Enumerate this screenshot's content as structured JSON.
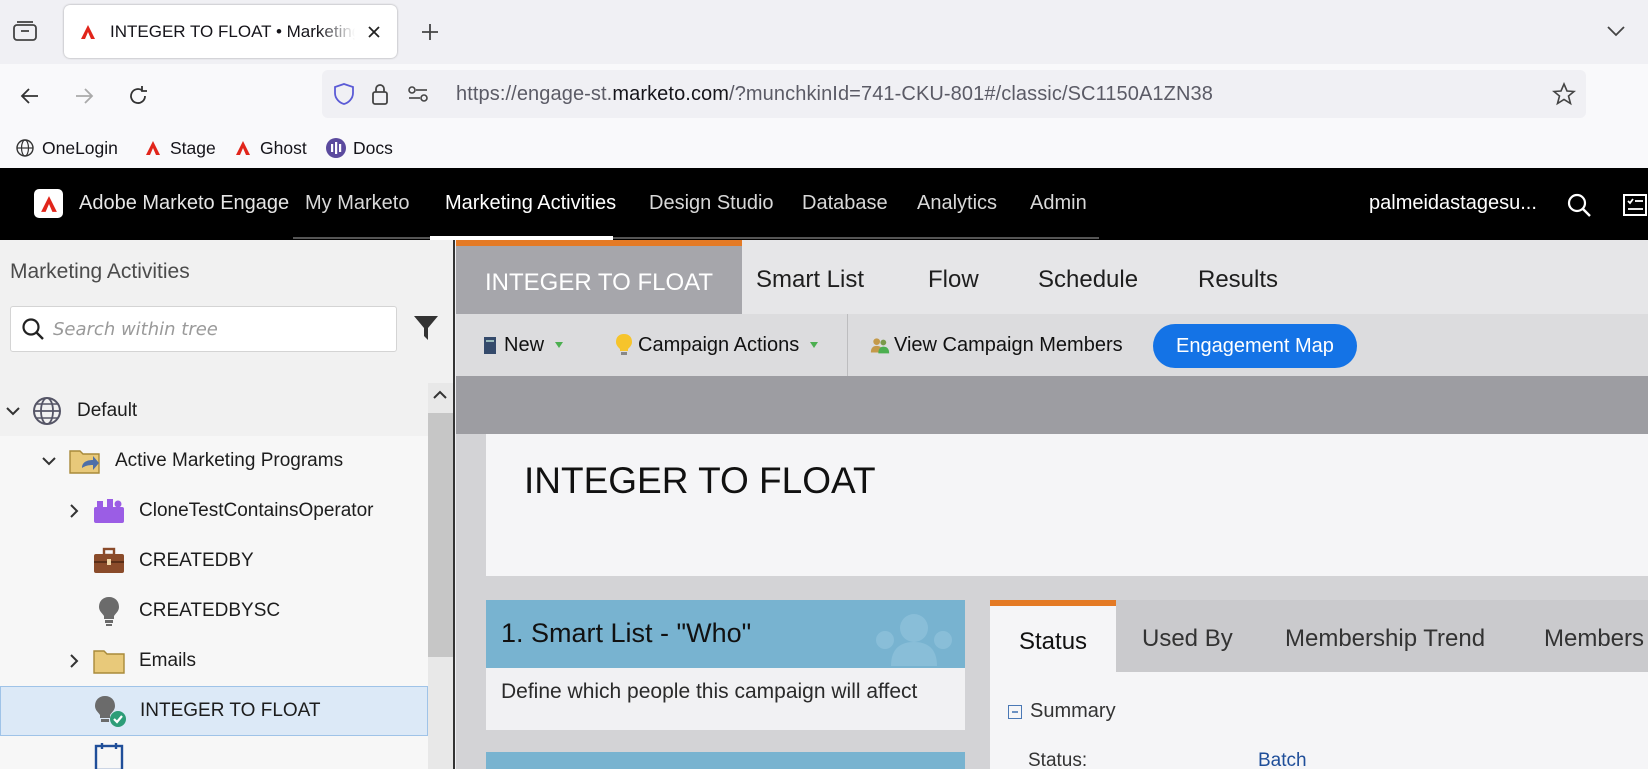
{
  "browser": {
    "tab_title": "INTEGER TO FLOAT • Marketing Activities",
    "url_prefix": "https://engage-st.",
    "url_domain": "marketo.com",
    "url_suffix": "/?munchkinId=741-CKU-801#/classic/SC1150A1ZN38",
    "bookmarks": [
      "OneLogin",
      "Stage",
      "Ghost",
      "Docs"
    ]
  },
  "header": {
    "brand": "Adobe Marketo Engage",
    "nav": [
      "My Marketo",
      "Marketing Activities",
      "Design Studio",
      "Database",
      "Analytics",
      "Admin"
    ],
    "active_nav": "Marketing Activities",
    "user": "palmeidastagesu..."
  },
  "tree": {
    "title": "Marketing Activities",
    "search_placeholder": "Search within tree",
    "items": [
      {
        "label": "Default",
        "icon": "globe-icon",
        "expanded": true
      },
      {
        "label": "Active Marketing Programs",
        "icon": "folder-share-icon",
        "expanded": true
      },
      {
        "label": "CloneTestContainsOperator",
        "icon": "program-icon",
        "expanded": false
      },
      {
        "label": "CREATEDBY",
        "icon": "briefcase-icon"
      },
      {
        "label": "CREATEDBYSC",
        "icon": "lightbulb-icon"
      },
      {
        "label": "Emails",
        "icon": "folder-icon",
        "expanded": false
      },
      {
        "label": "INTEGER TO FLOAT",
        "icon": "lightbulb-active-icon",
        "selected": true
      }
    ]
  },
  "content": {
    "tabs": [
      "INTEGER TO FLOAT",
      "Smart List",
      "Flow",
      "Schedule",
      "Results"
    ],
    "toolbar": {
      "new": "New",
      "campaign_actions": "Campaign Actions",
      "view_members": "View Campaign Members",
      "engagement_map": "Engagement Map"
    },
    "campaign_title": "INTEGER TO FLOAT",
    "smart_list_card": {
      "title": "1. Smart List - \"Who\"",
      "description": "Define which people this campaign will affect"
    },
    "status_tabs": [
      "Status",
      "Used By",
      "Membership Trend",
      "Members"
    ],
    "summary_label": "Summary",
    "status_label": "Status:",
    "status_value": "Batch"
  },
  "colors": {
    "accent_orange": "#e47a25",
    "engagement_blue": "#1473e6",
    "smart_list_blue": "#78b3d0",
    "header_black": "#000000"
  }
}
